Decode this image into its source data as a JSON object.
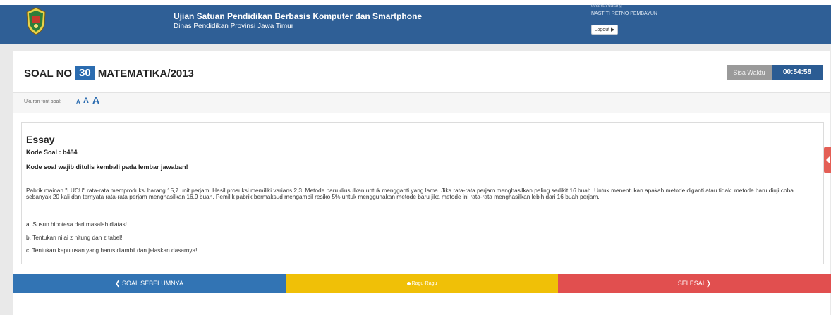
{
  "header": {
    "title": "Ujian Satuan Pendidikan Berbasis Komputer dan Smartphone",
    "subtitle": "Dinas Pendidikan Provinsi Jawa Timur",
    "user_line": "selamat datang",
    "user_name": "NASTITI RETNO PEMBAYUN",
    "logout_label": "Logout ▶"
  },
  "question_header": {
    "prefix": "SOAL NO",
    "number": "30",
    "subject": "MATEMATIKA/2013",
    "timer_label": "Sisa Waktu",
    "timer_value": "00:54:58"
  },
  "font_size": {
    "label": "Ukuran font soal:",
    "small": "A",
    "medium": "A",
    "large": "A"
  },
  "question": {
    "type": "Essay",
    "code": "Kode Soal : b484",
    "instruction": "Kode soal wajib ditulis kembali pada lembar jawaban!",
    "body": "Pabrik mainan \"LUCU\" rata-rata memproduksi barang 15,7 unit perjam. Hasil prosuksi memiliki varians 2,3. Metode baru diusulkan untuk mengganti yang lama. Jika rata-rata perjam menghasilkan paling sedikit 16 buah. Untuk menentukan apakah metode diganti atau tidak, metode baru diuji coba sebanyak 20 kali dan ternyata rata-rata perjam menghasilkan 16,9 buah. Pemilik pabrik bermaksud mengambil resiko 5% untuk menggunakan metode baru jika metode ini rata-rata menghasilkan lebih dari 16 buah perjam.",
    "items": [
      "a. Susun hipotesa dari masalah diatas!",
      "b. Tentukan nilai z hitung dan z tabel!",
      "c. Tentukan keputusan yang harus diambil dan jelaskan dasarnya!"
    ]
  },
  "nav": {
    "prev_label": "❮ SOAL SEBELUMNYA",
    "ragu_label": "Ragu-Ragu",
    "finish_label": "SELESAI ❯"
  },
  "colors": {
    "header_bg": "#2f5f96",
    "accent_blue": "#2b6cb0",
    "nav_prev": "#3274b4",
    "nav_ragu": "#f0c007",
    "nav_finish": "#e14f4f",
    "timer_label_bg": "#9a9a9a",
    "timer_value_bg": "#2b5c93"
  },
  "icons": {
    "logo": "east-java-crest-icon",
    "side_tab": "chevron-left-icon"
  }
}
